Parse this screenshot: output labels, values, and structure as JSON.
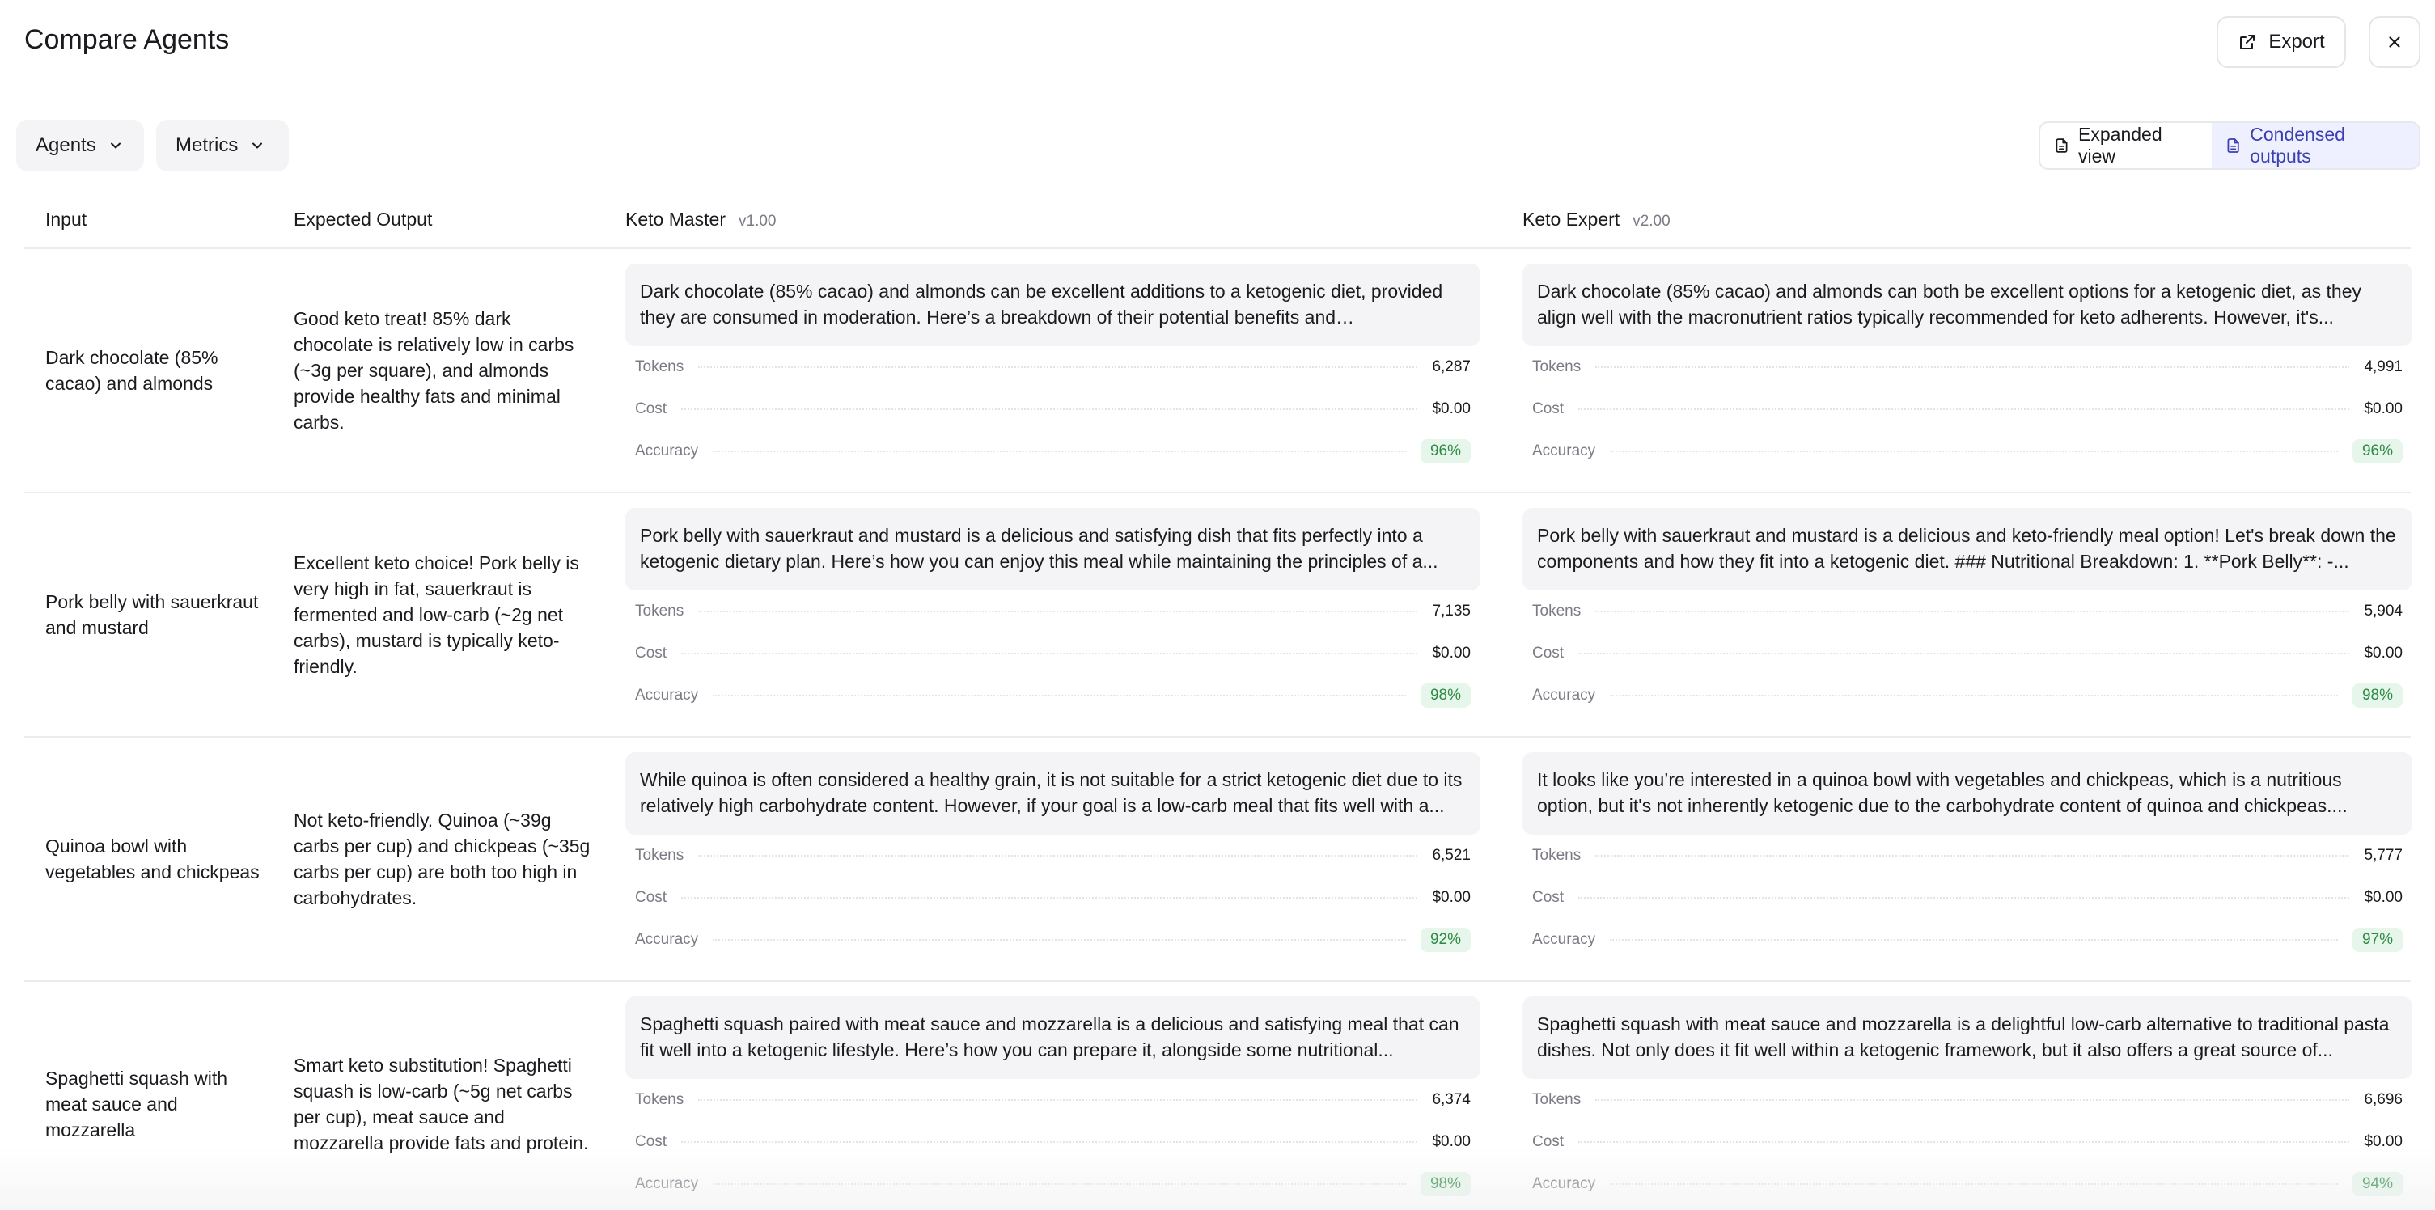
{
  "header": {
    "title": "Compare Agents",
    "export_label": "Export"
  },
  "toolbar": {
    "agents_label": "Agents",
    "metrics_label": "Metrics",
    "expanded_view_label": "Expanded view",
    "condensed_outputs_label": "Condensed outputs"
  },
  "columns": {
    "input": "Input",
    "expected": "Expected Output",
    "agent_a_name": "Keto Master",
    "agent_a_version": "v1.00",
    "agent_b_name": "Keto Expert",
    "agent_b_version": "v2.00"
  },
  "metric_labels": {
    "tokens": "Tokens",
    "cost": "Cost",
    "accuracy": "Accuracy"
  },
  "rows": [
    {
      "input": "Dark chocolate (85% cacao) and almonds",
      "expected": "Good keto treat! 85% dark chocolate is relatively low in carbs (~3g per square), and almonds provide healthy fats and minimal carbs.",
      "a": {
        "output": "Dark chocolate (85% cacao) and almonds can be excellent additions to a ketogenic diet, provided they are consumed in moderation. Here’s a breakdown of their potential benefits and considerations:...",
        "tokens": "6,287",
        "cost": "$0.00",
        "accuracy": "96%"
      },
      "b": {
        "output": "Dark chocolate (85% cacao) and almonds can both be excellent options for a ketogenic diet, as they align well with the macronutrient ratios typically recommended for keto adherents. However, it's...",
        "tokens": "4,991",
        "cost": "$0.00",
        "accuracy": "96%"
      }
    },
    {
      "input": "Pork belly with sauerkraut and mustard",
      "expected": "Excellent keto choice! Pork belly is very high in fat, sauerkraut is fermented and low-carb (~2g net carbs), mustard is typically keto-friendly.",
      "a": {
        "output": "Pork belly with sauerkraut and mustard is a delicious and satisfying dish that fits perfectly into a ketogenic dietary plan. Here’s how you can enjoy this meal while maintaining the principles of a...",
        "tokens": "7,135",
        "cost": "$0.00",
        "accuracy": "98%"
      },
      "b": {
        "output": "Pork belly with sauerkraut and mustard is a delicious and keto-friendly meal option! Let's break down the components and how they fit into a ketogenic diet. ### Nutritional Breakdown: 1. **Pork Belly**: -...",
        "tokens": "5,904",
        "cost": "$0.00",
        "accuracy": "98%"
      }
    },
    {
      "input": "Quinoa bowl with vegetables and chickpeas",
      "expected": "Not keto-friendly. Quinoa (~39g carbs per cup) and chickpeas (~35g carbs per cup) are both too high in carbohydrates.",
      "a": {
        "output": "While quinoa is often considered a healthy grain, it is not suitable for a strict ketogenic diet due to its relatively high carbohydrate content. However, if your goal is a low-carb meal that fits well with a...",
        "tokens": "6,521",
        "cost": "$0.00",
        "accuracy": "92%"
      },
      "b": {
        "output": "It looks like you’re interested in a quinoa bowl with vegetables and chickpeas, which is a nutritious option, but it's not inherently ketogenic due to the carbohydrate content of quinoa and chickpeas....",
        "tokens": "5,777",
        "cost": "$0.00",
        "accuracy": "97%"
      }
    },
    {
      "input": "Spaghetti squash with meat sauce and mozzarella",
      "expected": "Smart keto substitution! Spaghetti squash is low-carb (~5g net carbs per cup), meat sauce and mozzarella provide fats and protein.",
      "a": {
        "output": "Spaghetti squash paired with meat sauce and mozzarella is a delicious and satisfying meal that can fit well into a ketogenic lifestyle. Here’s how you can prepare it, alongside some nutritional...",
        "tokens": "6,374",
        "cost": "$0.00",
        "accuracy": "98%"
      },
      "b": {
        "output": "Spaghetti squash with meat sauce and mozzarella is a delightful low-carb alternative to traditional pasta dishes. Not only does it fit well within a ketogenic framework, but it also offers a great source of...",
        "tokens": "6,696",
        "cost": "$0.00",
        "accuracy": "94%"
      }
    }
  ]
}
